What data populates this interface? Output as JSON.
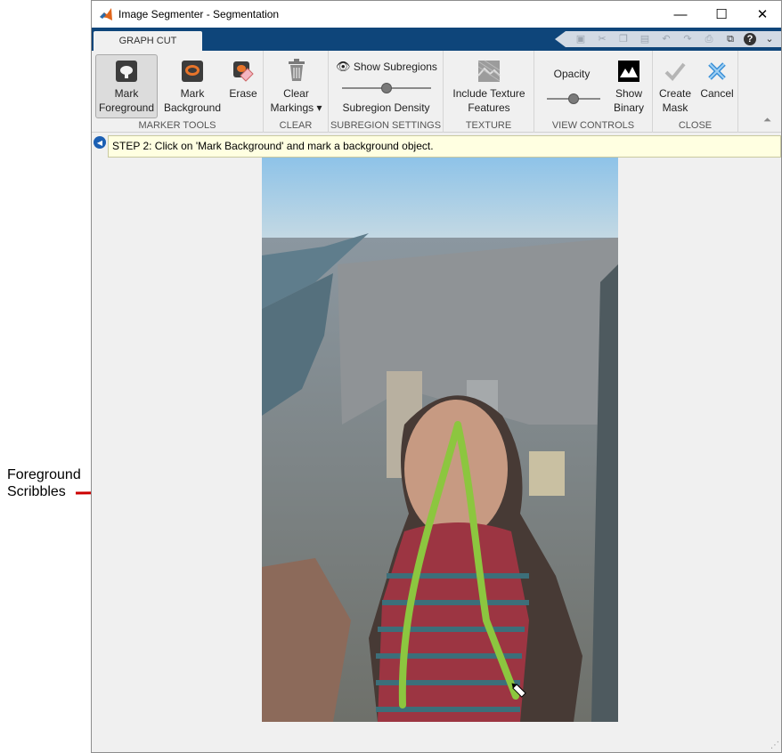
{
  "annotation": {
    "line1": "Foreground",
    "line2": "Scribbles",
    "arrow_color": "#cc0000"
  },
  "window": {
    "title": "Image Segmenter - Segmentation",
    "app_icon": "matlab-icon",
    "controls": {
      "minimize": "—",
      "maximize": "☐",
      "close": "✕"
    }
  },
  "tab": {
    "label": "GRAPH CUT"
  },
  "ribbon": {
    "marker_tools": {
      "label": "MARKER TOOLS",
      "mark_foreground": [
        "Mark",
        "Foreground"
      ],
      "mark_background": [
        "Mark",
        "Background"
      ],
      "erase": "Erase"
    },
    "clear": {
      "label": "CLEAR",
      "clear_markings": [
        "Clear",
        "Markings ▾"
      ]
    },
    "subregion_settings": {
      "label": "SUBREGION SETTINGS",
      "show_subregions": "Show Subregions",
      "subregion_density": "Subregion Density",
      "density_level": 0.5
    },
    "texture": {
      "label": "TEXTURE",
      "include_texture": [
        "Include Texture",
        "Features"
      ]
    },
    "view_controls": {
      "label": "VIEW CONTROLS",
      "opacity": "Opacity",
      "opacity_level": 0.5,
      "show_binary": [
        "Show",
        "Binary"
      ]
    },
    "close": {
      "label": "CLOSE",
      "create_mask": [
        "Create",
        "Mask"
      ],
      "cancel": "Cancel"
    }
  },
  "hint": {
    "text": "STEP 2: Click on 'Mark Background' and mark a background object."
  },
  "colors": {
    "tabstrip": "#0e457a",
    "scribble": "#8cc63f",
    "hint_bg": "#ffffe1",
    "cancel_x": "#3a8fd6"
  }
}
